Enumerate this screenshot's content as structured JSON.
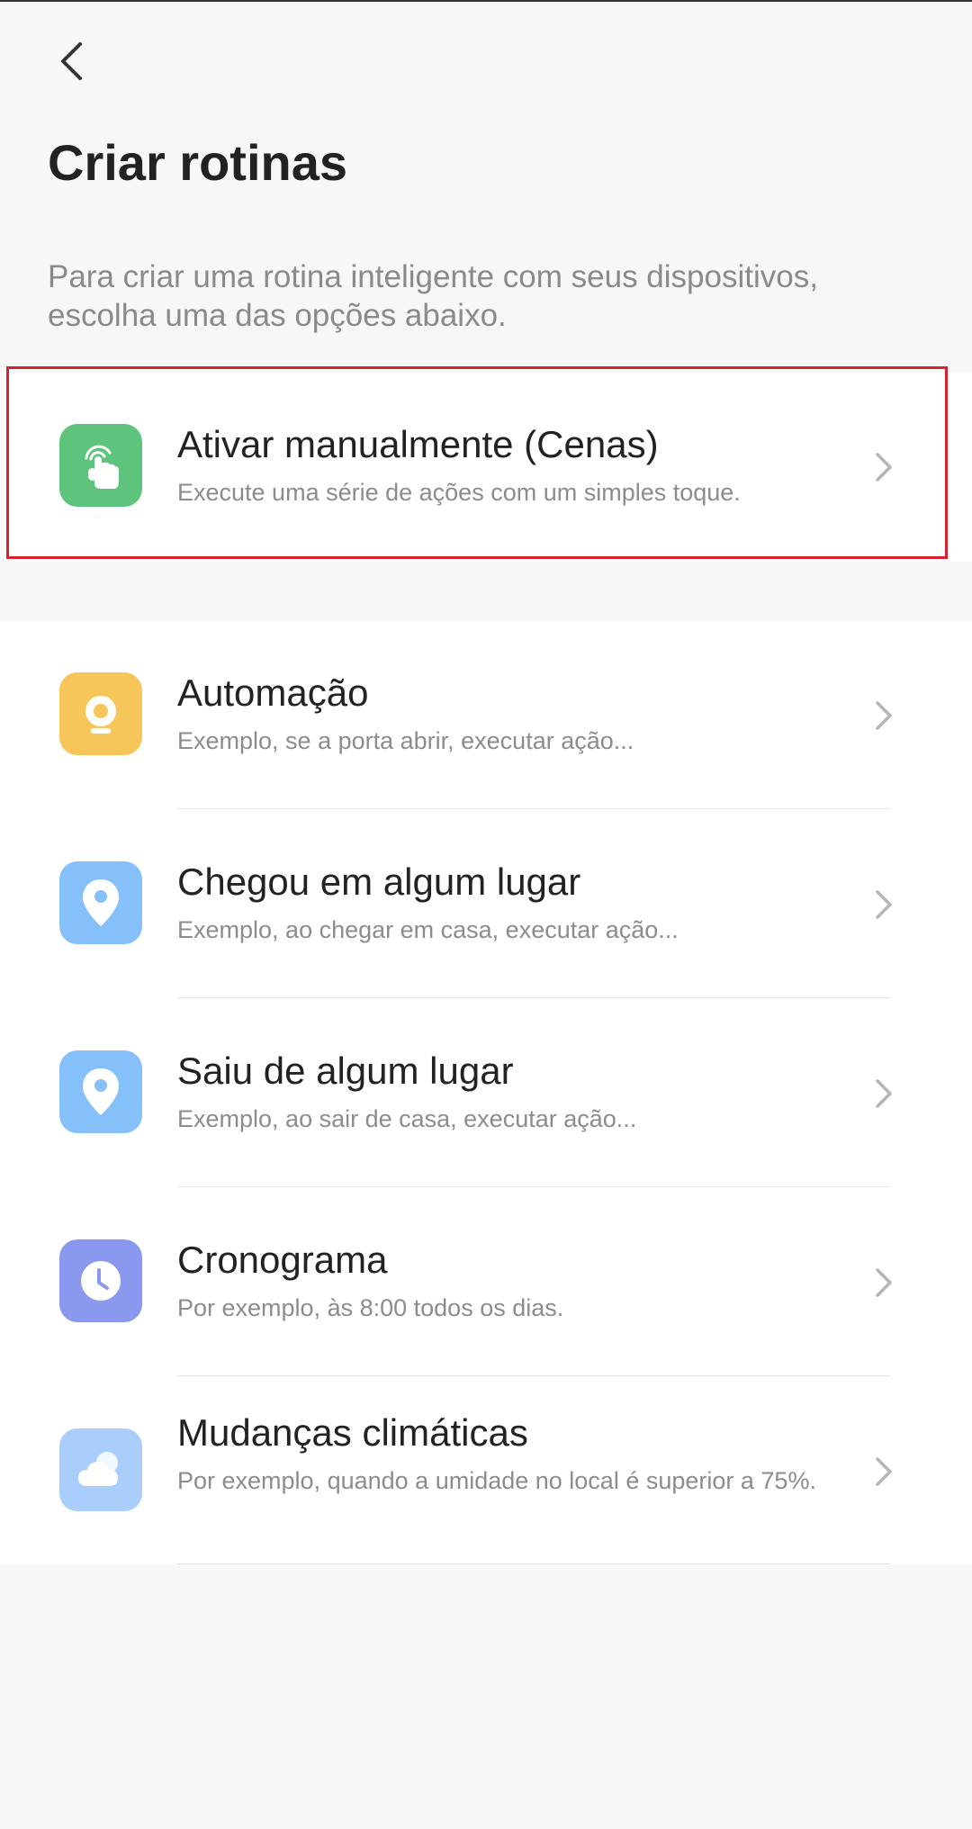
{
  "header": {
    "back_label": "Voltar",
    "title": "Criar rotinas",
    "description": "Para criar uma rotina inteligente com seus dispositivos, escolha uma das opções abaixo."
  },
  "options": [
    {
      "title": "Ativar manualmente (Cenas)",
      "subtitle": "Execute uma série de ações com um simples toque.",
      "icon": "hand-tap-icon",
      "color": "#5ec47d"
    },
    {
      "title": "Automação",
      "subtitle": "Exemplo, se a porta abrir, executar ação...",
      "icon": "webcam-icon",
      "color": "#f7c65a"
    },
    {
      "title": "Chegou em algum lugar",
      "subtitle": "Exemplo, ao chegar em casa, executar ação...",
      "icon": "location-pin-icon",
      "color": "#86c0fb"
    },
    {
      "title": "Saiu de algum lugar",
      "subtitle": "Exemplo, ao sair de casa, executar ação...",
      "icon": "location-pin-icon",
      "color": "#86c0fb"
    },
    {
      "title": "Cronograma",
      "subtitle": "Por exemplo, às 8:00 todos os dias.",
      "icon": "clock-icon",
      "color": "#8a98ee"
    },
    {
      "title": "Mudanças climáticas",
      "subtitle": "Por exemplo, quando a umidade no local é superior a 75%.",
      "icon": "weather-icon",
      "color": "#a9cefb"
    }
  ],
  "colors": {
    "background": "#f7f7f7",
    "card": "#ffffff",
    "highlight": "#d9222f"
  }
}
